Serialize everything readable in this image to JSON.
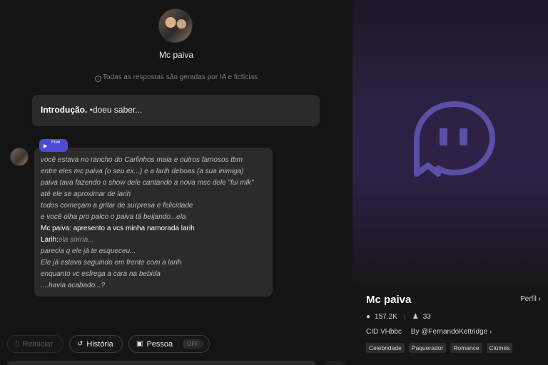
{
  "character": {
    "name": "Mc paiva",
    "disclaimer": "Todas as respostas são geradas por IA e fictícias"
  },
  "intro": {
    "label": "Introdução.",
    "text": "•doeu saber..."
  },
  "message": {
    "badge": "Free",
    "lines": [
      "você estava no rancho do Carlinhos maia e outros famosos tbm",
      "entre eles mc paiva (o seu ex...) e a larih deboas (a sua inimiga)",
      "paiva tava fazendo o show dele cantando a nova msc dele \"fui mlk\"",
      "até ele se aproximar de larih",
      "todos começam a gritar de surpresa e felicidade",
      "e você olha pro palco o paiva tá beijando...ela"
    ],
    "speech": "Mc paiva: apresento a vcs minha namorada larih",
    "speaker2": "Larih:",
    "speaker2_action": "ela sorria...",
    "lines_after": [
      "parecia q ele já te esqueceu...",
      "Ele já estava seguindo em frente com a larih",
      "enquanto vc esfrega a cara na bebida",
      "....havia acabado...?"
    ]
  },
  "toolbar": {
    "restart": "Reiniciar",
    "history": "História",
    "persona": "Pessoa",
    "persona_state": "OFF"
  },
  "profile": {
    "name": "Mc paiva",
    "profile_link": "Perfil ›",
    "chats": "157.2K",
    "likes": "33",
    "cid": "CID VHbbc",
    "creator": "By @FernandoKettridge ›",
    "tags": [
      "Celebridade",
      "Paquerador",
      "Romance",
      "Ciúmes"
    ]
  },
  "colors": {
    "accent": "#4d4ad6",
    "ghost_icon": "#5b4fa6"
  }
}
